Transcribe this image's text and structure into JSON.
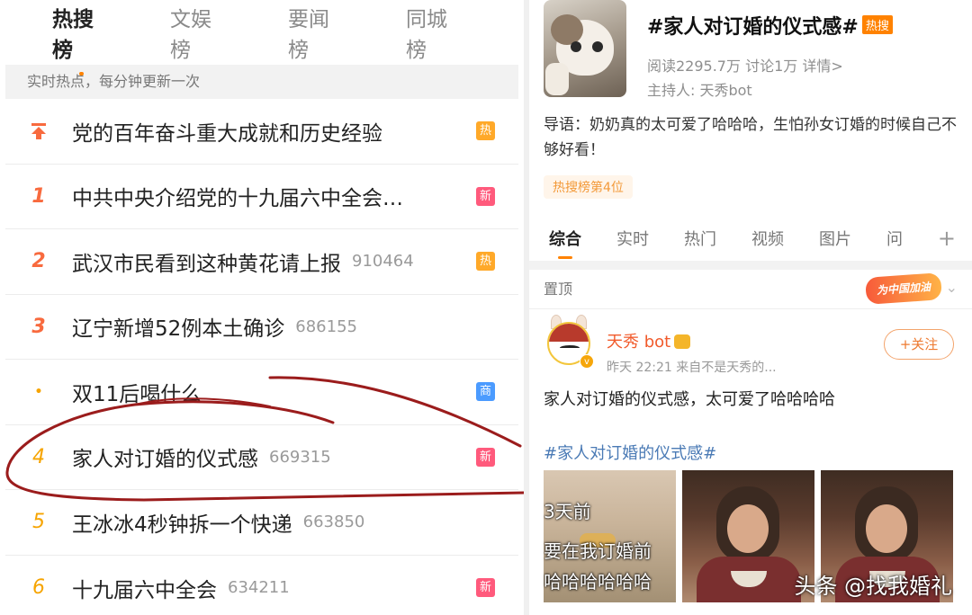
{
  "left": {
    "tabs": [
      {
        "label": "热搜榜",
        "active": true
      },
      {
        "label": "文娱榜",
        "active": false
      },
      {
        "label": "要闻榜",
        "active": false
      },
      {
        "label": "同城榜",
        "active": false
      }
    ],
    "subheader": "实时热点，每分钟更新一次",
    "items": [
      {
        "rank": "",
        "type": "pinned",
        "title": "党的百年奋斗重大成就和历史经验",
        "count": "",
        "badge": "热",
        "badge_type": "hot"
      },
      {
        "rank": "1",
        "type": "top",
        "title": "中共中央介绍党的十九届六中全会…",
        "count": "",
        "badge": "新",
        "badge_type": "new"
      },
      {
        "rank": "2",
        "type": "top",
        "title": "武汉市民看到这种黄花请上报",
        "count": "910464",
        "badge": "热",
        "badge_type": "hot"
      },
      {
        "rank": "3",
        "type": "top",
        "title": "辽宁新增52例本土确诊",
        "count": "686155",
        "badge": "",
        "badge_type": ""
      },
      {
        "rank": "•",
        "type": "ad",
        "title": "双11后喝什么",
        "count": "",
        "badge": "商",
        "badge_type": "biz"
      },
      {
        "rank": "4",
        "type": "normal",
        "title": "家人对订婚的仪式感",
        "count": "669315",
        "badge": "新",
        "badge_type": "new"
      },
      {
        "rank": "5",
        "type": "normal",
        "title": "王冰冰4秒钟拆一个快递",
        "count": "663850",
        "badge": "",
        "badge_type": ""
      },
      {
        "rank": "6",
        "type": "normal",
        "title": "十九届六中全会",
        "count": "634211",
        "badge": "新",
        "badge_type": "new"
      }
    ],
    "colors": {
      "accent": "#ff8200",
      "rank_top": "#f86a3e",
      "rank_normal": "#f6a400",
      "annotation": "#9b1c1c"
    }
  },
  "right": {
    "topic": {
      "title": "#家人对订婚的仪式感#",
      "hot_label": "热搜",
      "stats": "阅读2295.7万  讨论1万  详情>",
      "host": "主持人: 天秀bot",
      "lead": "导语：奶奶真的太可爱了哈哈哈，生怕孙女订婚的时候自己不够好看！",
      "rank_pill": "热搜榜第4位"
    },
    "tabs": [
      {
        "label": "综合",
        "active": true
      },
      {
        "label": "实时",
        "active": false
      },
      {
        "label": "热门",
        "active": false
      },
      {
        "label": "视频",
        "active": false
      },
      {
        "label": "图片",
        "active": false
      },
      {
        "label": "问",
        "active": false
      }
    ],
    "plus_label": "+",
    "pinned_label": "置顶",
    "sticker_text": "为中国加油",
    "post": {
      "user": "天秀 bot",
      "meta": "昨天 22:21  来自不是天秀的...",
      "follow": "+关注",
      "text": "家人对订婚的仪式感，太可爱了哈哈哈哈",
      "tag": "#家人对订婚的仪式感#"
    },
    "thumb1_lines": [
      "3天前",
      "要在我订婚前",
      "哈哈哈哈哈哈"
    ],
    "watermark": "头条 @找我婚礼"
  }
}
